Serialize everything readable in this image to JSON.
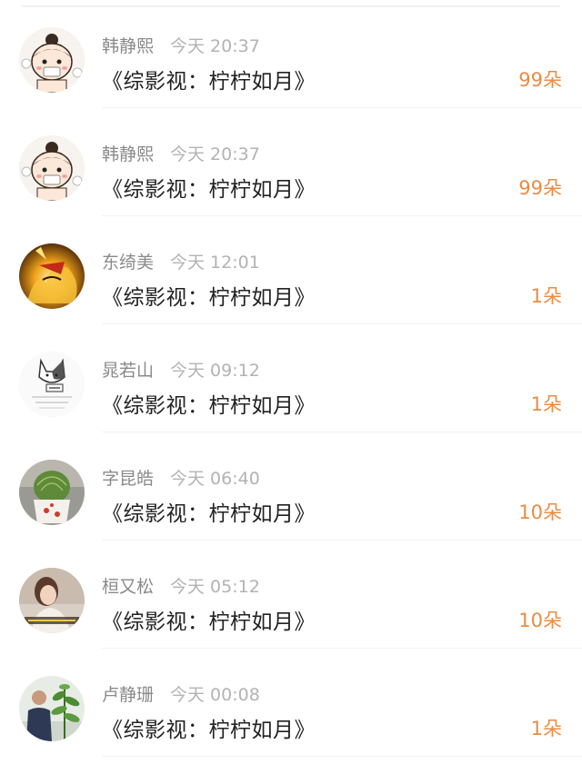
{
  "list": {
    "items": [
      {
        "name": "韩静熙",
        "time": "今天 20:37",
        "title": "《综影视：柠柠如月》",
        "count": "99朵",
        "avatar": "cartoon-girl-avatar"
      },
      {
        "name": "韩静熙",
        "time": "今天 20:37",
        "title": "《综影视：柠柠如月》",
        "count": "99朵",
        "avatar": "cartoon-girl-avatar"
      },
      {
        "name": "东绮美",
        "time": "今天 12:01",
        "title": "《综影视：柠柠如月》",
        "count": "1朵",
        "avatar": "anime-fire-avatar"
      },
      {
        "name": "晁若山",
        "time": "今天 09:12",
        "title": "《综影视：柠柠如月》",
        "count": "1朵",
        "avatar": "cat-sketch-avatar"
      },
      {
        "name": "字昆皓",
        "time": "今天 06:40",
        "title": "《综影视：柠柠如月》",
        "count": "10朵",
        "avatar": "cactus-avatar"
      },
      {
        "name": "桓又松",
        "time": "今天 05:12",
        "title": "《综影视：柠柠如月》",
        "count": "10朵",
        "avatar": "woman-photo-avatar"
      },
      {
        "name": "卢静珊",
        "time": "今天 00:08",
        "title": "《综影视：柠柠如月》",
        "count": "1朵",
        "avatar": "man-plant-avatar"
      }
    ]
  },
  "colors": {
    "count_accent": "#ea8c45",
    "name_gray": "#8a8a8a",
    "time_gray": "#b3b3b3",
    "title_text": "#222222"
  }
}
